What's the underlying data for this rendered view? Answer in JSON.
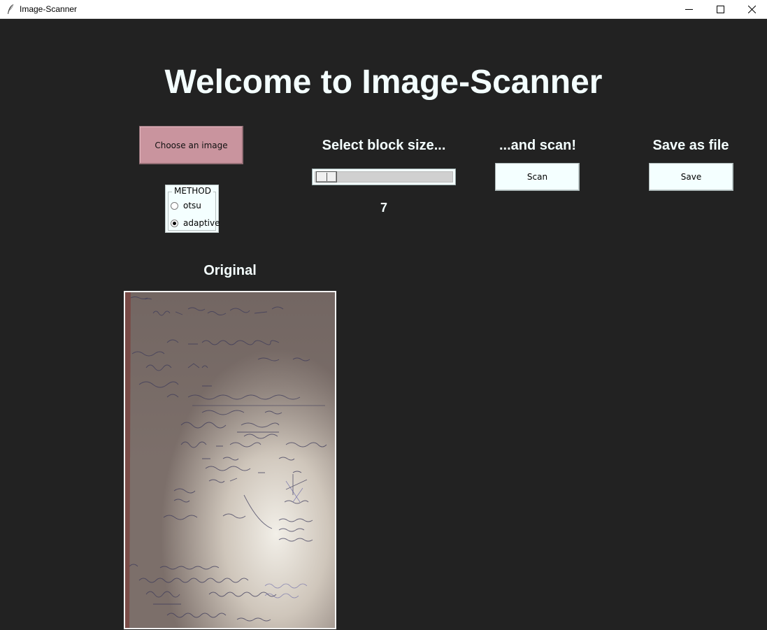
{
  "window": {
    "title": "Image-Scanner"
  },
  "heading": "Welcome to Image-Scanner",
  "choose_button": {
    "label": "Choose an image"
  },
  "method": {
    "legend": "METHOD",
    "options": [
      {
        "label": "otsu",
        "checked": false
      },
      {
        "label": "adaptive",
        "checked": true
      }
    ]
  },
  "block_size": {
    "label": "Select block size...",
    "value": "7"
  },
  "scan": {
    "label": "...and scan!",
    "button_label": "Scan"
  },
  "save": {
    "label": "Save as file",
    "button_label": "Save"
  },
  "preview": {
    "label": "Original"
  },
  "colors": {
    "background": "#222222",
    "heading_text": "#f4ffff",
    "choose_button_bg": "#c9949e",
    "button_bg": "#f4ffff"
  }
}
